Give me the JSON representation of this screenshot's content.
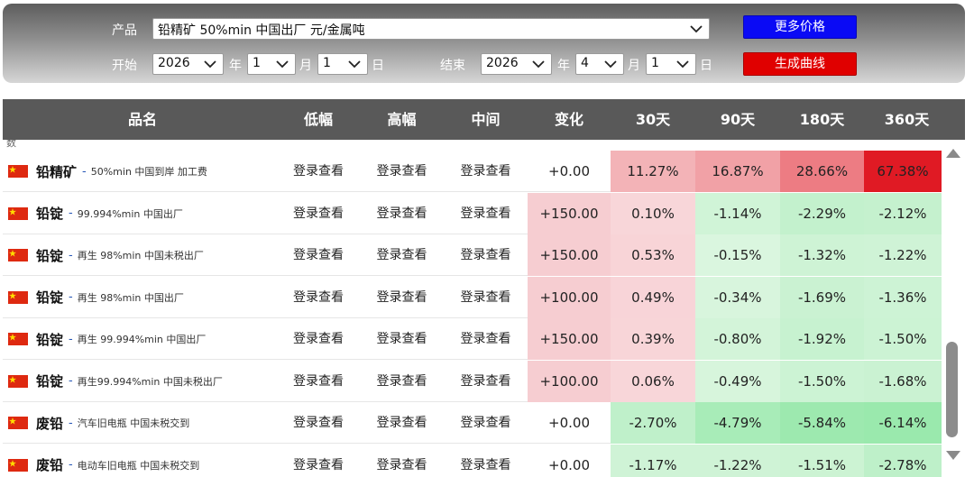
{
  "filters": {
    "product_label": "产品",
    "product_value": "铅精矿 50%min 中国出厂 元/金属吨",
    "more_prices_button": "更多价格",
    "generate_curve_button": "生成曲线",
    "start_label": "开始",
    "end_label": "结束",
    "year_unit": "年",
    "month_unit": "月",
    "day_unit": "日",
    "start_year": "2026",
    "start_month": "1",
    "start_day": "1",
    "end_year": "2026",
    "end_month": "4",
    "end_day": "1"
  },
  "table": {
    "headers": [
      "品名",
      "低幅",
      "高幅",
      "中间",
      "变化",
      "30天",
      "90天",
      "180天",
      "360天"
    ],
    "partial_top_text": "数",
    "login_text": "登录查看",
    "rows": [
      {
        "name": "铅精矿",
        "desc": "50%min 中国到岸 加工费",
        "low": "登录查看",
        "high": "登录查看",
        "mid": "登录查看",
        "change": "+0.00",
        "d30": "11.27%",
        "d90": "16.87%",
        "d180": "28.66%",
        "d360": "67.38%"
      },
      {
        "name": "铅锭",
        "desc": "99.994%min 中国出厂",
        "low": "登录查看",
        "high": "登录查看",
        "mid": "登录查看",
        "change": "+150.00",
        "d30": "0.10%",
        "d90": "-1.14%",
        "d180": "-2.29%",
        "d360": "-2.12%"
      },
      {
        "name": "铅锭",
        "desc": "再生 98%min 中国未税出厂",
        "low": "登录查看",
        "high": "登录查看",
        "mid": "登录查看",
        "change": "+150.00",
        "d30": "0.53%",
        "d90": "-0.15%",
        "d180": "-1.32%",
        "d360": "-1.22%"
      },
      {
        "name": "铅锭",
        "desc": "再生 98%min 中国出厂",
        "low": "登录查看",
        "high": "登录查看",
        "mid": "登录查看",
        "change": "+100.00",
        "d30": "0.49%",
        "d90": "-0.34%",
        "d180": "-1.69%",
        "d360": "-1.36%"
      },
      {
        "name": "铅锭",
        "desc": "再生 99.994%min 中国出厂",
        "low": "登录查看",
        "high": "登录查看",
        "mid": "登录查看",
        "change": "+150.00",
        "d30": "0.39%",
        "d90": "-0.80%",
        "d180": "-1.92%",
        "d360": "-1.50%"
      },
      {
        "name": "铅锭",
        "desc": "再生99.994%min 中国未税出厂",
        "low": "登录查看",
        "high": "登录查看",
        "mid": "登录查看",
        "change": "+100.00",
        "d30": "0.06%",
        "d90": "-0.49%",
        "d180": "-1.50%",
        "d360": "-1.68%"
      },
      {
        "name": "废铅",
        "desc": "汽车旧电瓶 中国未税交到",
        "low": "登录查看",
        "high": "登录查看",
        "mid": "登录查看",
        "change": "+0.00",
        "d30": "-2.70%",
        "d90": "-4.79%",
        "d180": "-5.84%",
        "d360": "-6.14%"
      },
      {
        "name": "废铅",
        "desc": "电动车旧电瓶 中国未税交到",
        "low": "登录查看",
        "high": "登录查看",
        "mid": "登录查看",
        "change": "+0.00",
        "d30": "-1.17%",
        "d90": "-1.22%",
        "d180": "-1.51%",
        "d360": "-2.78%"
      }
    ]
  },
  "colors": {
    "more_button": "#0a0af5",
    "curve_button": "#e00000",
    "header_bg": "#595959",
    "increase_strong": "#e01a24",
    "decrease_strong": "#9fe8b0"
  }
}
